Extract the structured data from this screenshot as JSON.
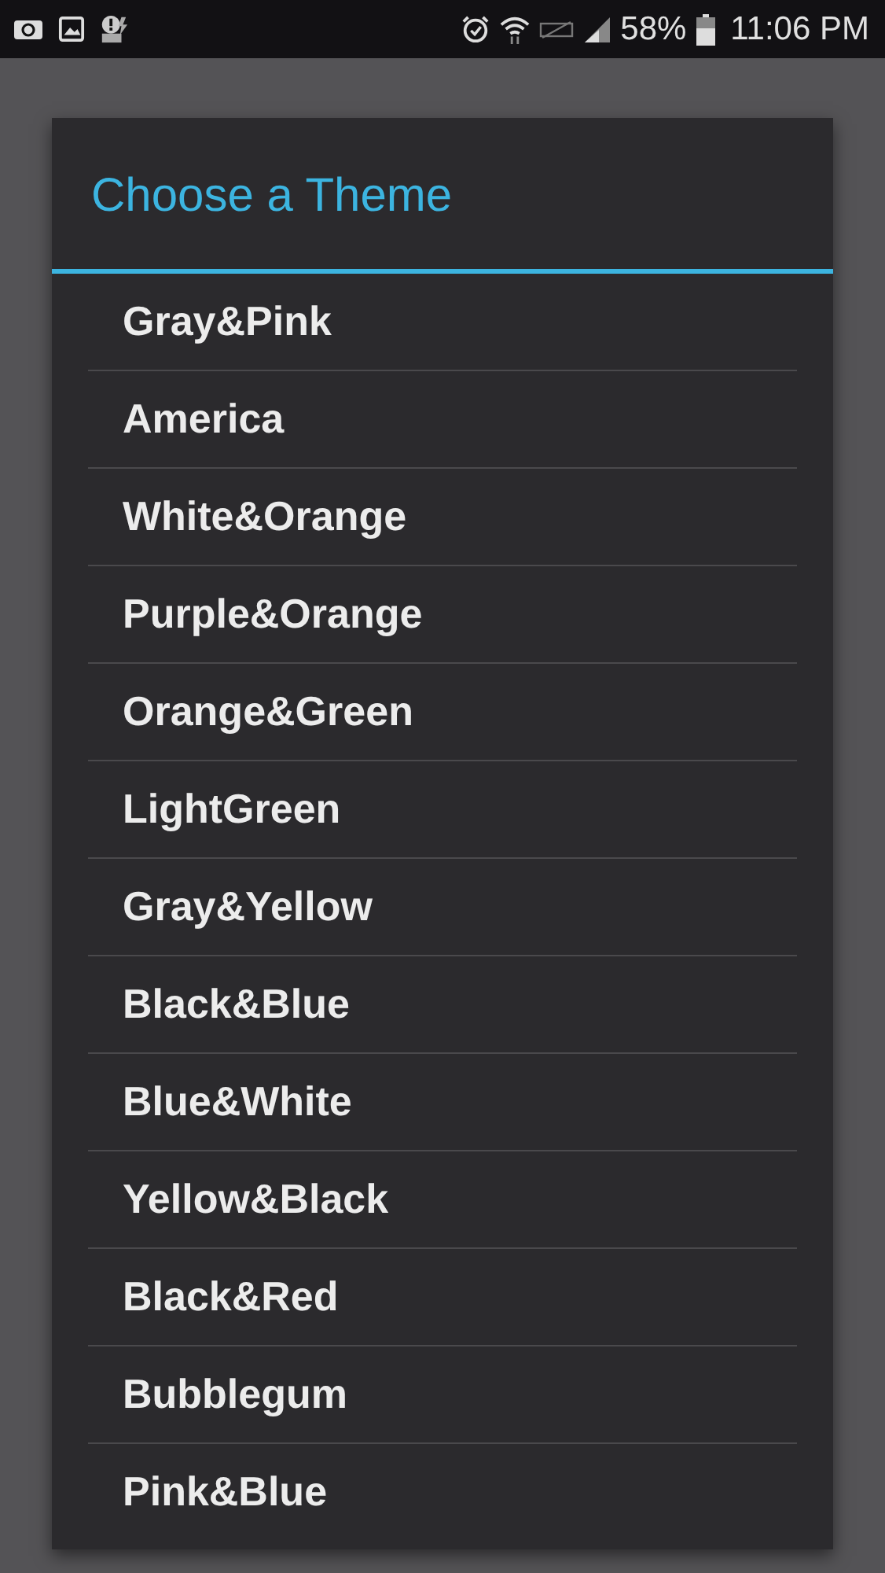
{
  "status_bar": {
    "battery_text": "58%",
    "time": "11:06 PM"
  },
  "dialog": {
    "title": "Choose a Theme",
    "items": [
      {
        "label": "Gray&Pink"
      },
      {
        "label": "America"
      },
      {
        "label": "White&Orange"
      },
      {
        "label": "Purple&Orange"
      },
      {
        "label": "Orange&Green"
      },
      {
        "label": "LightGreen"
      },
      {
        "label": "Gray&Yellow"
      },
      {
        "label": "Black&Blue"
      },
      {
        "label": "Blue&White"
      },
      {
        "label": "Yellow&Black"
      },
      {
        "label": "Black&Red"
      },
      {
        "label": "Bubblegum"
      },
      {
        "label": "Pink&Blue"
      }
    ]
  }
}
